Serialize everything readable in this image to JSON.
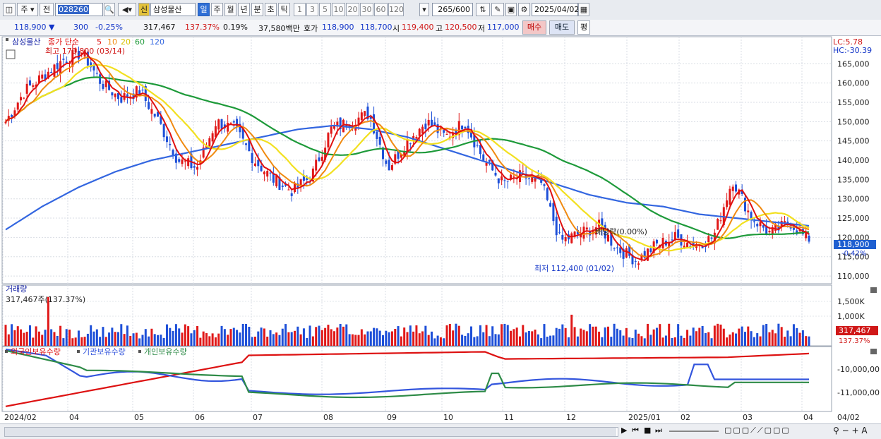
{
  "toolbar": {
    "type_main": "주",
    "type_all": "전",
    "code": "028260",
    "badge_credit": "신",
    "stock_name": "삼성물산",
    "periods": [
      "일",
      "주",
      "월",
      "년",
      "분",
      "초",
      "틱"
    ],
    "period_active": "일",
    "intervals": [
      "1",
      "3",
      "5",
      "10",
      "20",
      "30",
      "60",
      "120"
    ],
    "count": "265",
    "count_total": "/600",
    "date": "2025/04/02"
  },
  "quote": {
    "price": "118,900",
    "change": "300",
    "change_pct": "-0.25%",
    "volume": "317,467",
    "volume_ratio": "137.37%",
    "turnover": "0.19%",
    "amount": "37,580백만",
    "hoga_label": "호가",
    "ask": "118,900",
    "bid": "118,700",
    "open_label": "시",
    "open": "119,400",
    "high_label": "고",
    "high": "120,500",
    "low_label": "저",
    "low": "117,000",
    "buy_label": "매수",
    "sell_label": "매도",
    "avg_label": "평"
  },
  "legend": {
    "name": "삼성물산",
    "ma_prefix": "종가 단순",
    "ma": [
      {
        "period": "5",
        "color": "#e01010"
      },
      {
        "period": "10",
        "color": "#f08a10"
      },
      {
        "period": "20",
        "color": "#f2e020"
      },
      {
        "period": "60",
        "color": "#1e9a3a"
      },
      {
        "period": "120",
        "color": "#3366e0"
      }
    ],
    "lc": "LC:5.78",
    "hc": "HC:-30.39"
  },
  "annotations": {
    "high": "최고 170,800 (03/14)",
    "low": "최저 112,400 (01/02)",
    "dividend": "배당락(0.00%)",
    "last_price": "118,900",
    "last_pct": "-0.42%"
  },
  "volume_panel": {
    "title": "거래량",
    "info": "317,467주(137.37%)",
    "last": "317,467",
    "last_pct": "137.37%"
  },
  "holdings_panel": {
    "series": [
      {
        "name": "외국인보유수량",
        "color": "#dd1111"
      },
      {
        "name": "기관보유수량",
        "color": "#3355dd"
      },
      {
        "name": "개인보유수량",
        "color": "#2e8b47"
      }
    ],
    "ticks": [
      "-10,000,00",
      "-11,000,00"
    ]
  },
  "x_axis": {
    "labels": [
      "2024/02",
      "04",
      "05",
      "06",
      "07",
      "08",
      "09",
      "10",
      "11",
      "12",
      "2025/01",
      "02",
      "03",
      "04"
    ],
    "right_label": "04/02"
  },
  "chart_data": {
    "type": "candlestick",
    "title": "삼성물산",
    "ylim": [
      108000,
      172000
    ],
    "y_ticks": [
      110000,
      115000,
      120000,
      125000,
      130000,
      135000,
      140000,
      145000,
      150000,
      155000,
      160000,
      165000
    ],
    "months": [
      "2024/02",
      "03",
      "04",
      "05",
      "06",
      "07",
      "08",
      "09",
      "10",
      "11",
      "12",
      "2025/01",
      "02",
      "03",
      "04"
    ],
    "close_path": [
      {
        "m": "2024/02 early",
        "v": 150000
      },
      {
        "m": "2024/02 mid",
        "v": 158000
      },
      {
        "m": "2024/02 late",
        "v": 162000
      },
      {
        "m": "2024/03 early",
        "v": 166000
      },
      {
        "m": "2024/03/14",
        "v": 168000
      },
      {
        "m": "2024/03 mid",
        "v": 160000
      },
      {
        "m": "2024/03 late",
        "v": 156000
      },
      {
        "m": "2024/04 early",
        "v": 158000
      },
      {
        "m": "2024/04 mid",
        "v": 150000
      },
      {
        "m": "2024/04 late",
        "v": 140000
      },
      {
        "m": "2024/05 early",
        "v": 138000
      },
      {
        "m": "2024/05 mid",
        "v": 150000
      },
      {
        "m": "2024/05 late",
        "v": 148000
      },
      {
        "m": "2024/06 early",
        "v": 140000
      },
      {
        "m": "2024/06 mid",
        "v": 135000
      },
      {
        "m": "2024/06 late",
        "v": 132000
      },
      {
        "m": "2024/07 early",
        "v": 136000
      },
      {
        "m": "2024/07 mid",
        "v": 148000
      },
      {
        "m": "2024/07 late",
        "v": 150000
      },
      {
        "m": "2024/08 early",
        "v": 152000
      },
      {
        "m": "2024/08 mid",
        "v": 138000
      },
      {
        "m": "2024/08 late",
        "v": 145000
      },
      {
        "m": "2024/09 early",
        "v": 150000
      },
      {
        "m": "2024/09 mid",
        "v": 146000
      },
      {
        "m": "2024/09 late",
        "v": 150000
      },
      {
        "m": "2024/10 early",
        "v": 140000
      },
      {
        "m": "2024/10 mid",
        "v": 134000
      },
      {
        "m": "2024/10 late",
        "v": 136000
      },
      {
        "m": "2024/11 early",
        "v": 134000
      },
      {
        "m": "2024/11 mid",
        "v": 119000
      },
      {
        "m": "2024/11 late",
        "v": 121000
      },
      {
        "m": "2024/12 early",
        "v": 123000
      },
      {
        "m": "2024/12 mid",
        "v": 117000
      },
      {
        "m": "2025/01/02",
        "v": 114000
      },
      {
        "m": "2025/01 mid",
        "v": 118000
      },
      {
        "m": "2025/01 late",
        "v": 120000
      },
      {
        "m": "2025/02 early",
        "v": 118000
      },
      {
        "m": "2025/02 mid",
        "v": 120000
      },
      {
        "m": "2025/02 late",
        "v": 135000
      },
      {
        "m": "2025/03 early",
        "v": 125000
      },
      {
        "m": "2025/03 mid",
        "v": 121000
      },
      {
        "m": "2025/03 late",
        "v": 124000
      },
      {
        "m": "2025/04/02",
        "v": 118900
      }
    ],
    "moving_averages": [
      {
        "name": "MA5",
        "values": [
          150000,
          158000,
          163000,
          165000,
          162000,
          157000,
          156000,
          149000,
          141000,
          145000,
          147000,
          139000,
          134000,
          133000,
          137000,
          147000,
          150000,
          149000,
          141000,
          145000,
          149000,
          147000,
          145000,
          137000,
          134000,
          130000,
          120000,
          121000,
          120000,
          116000,
          117000,
          119000,
          120000,
          128000,
          130000,
          124000,
          122000,
          123000,
          118900
        ]
      },
      {
        "name": "MA120",
        "values": [
          122000,
          128000,
          133000,
          137000,
          140000,
          142000,
          144000,
          146000,
          148000,
          149000,
          148000,
          146000,
          143000,
          140000,
          137000,
          134000,
          131000,
          129000,
          128000,
          126000,
          125000,
          124000,
          123000
        ]
      }
    ],
    "volume": {
      "ylim": [
        0,
        2000000
      ],
      "y_ticks": [
        1000000,
        1500000
      ],
      "max_bar": 1650000,
      "last": 317467
    }
  }
}
